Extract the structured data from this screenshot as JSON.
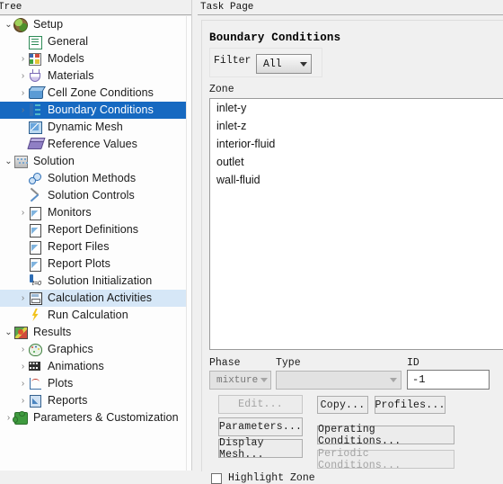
{
  "tree_panel": {
    "header": "Tree",
    "items": [
      {
        "label": "Setup",
        "icon": "setup-globe-icon",
        "level": 0,
        "arrow": "expanded",
        "state": "normal"
      },
      {
        "label": "General",
        "icon": "general-document-icon",
        "level": 1,
        "arrow": "none",
        "state": "normal"
      },
      {
        "label": "Models",
        "icon": "models-squares-icon",
        "level": 1,
        "arrow": "collapsed",
        "state": "normal"
      },
      {
        "label": "Materials",
        "icon": "materials-flask-icon",
        "level": 1,
        "arrow": "collapsed",
        "state": "normal"
      },
      {
        "label": "Cell Zone Conditions",
        "icon": "cell-zone-box-icon",
        "level": 1,
        "arrow": "collapsed",
        "state": "normal"
      },
      {
        "label": "Boundary Conditions",
        "icon": "boundary-conditions-icon",
        "level": 1,
        "arrow": "collapsed",
        "state": "selected"
      },
      {
        "label": "Dynamic Mesh",
        "icon": "dynamic-mesh-icon",
        "level": 1,
        "arrow": "none",
        "state": "normal"
      },
      {
        "label": "Reference Values",
        "icon": "reference-values-book-icon",
        "level": 1,
        "arrow": "none",
        "state": "normal"
      },
      {
        "label": "Solution",
        "icon": "solution-building-icon",
        "level": 0,
        "arrow": "expanded",
        "state": "normal"
      },
      {
        "label": "Solution Methods",
        "icon": "solution-methods-icon",
        "level": 1,
        "arrow": "none",
        "state": "normal"
      },
      {
        "label": "Solution Controls",
        "icon": "solution-controls-icon",
        "level": 1,
        "arrow": "none",
        "state": "normal"
      },
      {
        "label": "Monitors",
        "icon": "monitors-document-icon",
        "level": 1,
        "arrow": "collapsed",
        "state": "normal"
      },
      {
        "label": "Report Definitions",
        "icon": "report-definitions-icon",
        "level": 1,
        "arrow": "none",
        "state": "normal"
      },
      {
        "label": "Report Files",
        "icon": "report-files-icon",
        "level": 1,
        "arrow": "none",
        "state": "normal"
      },
      {
        "label": "Report Plots",
        "icon": "report-plots-icon",
        "level": 1,
        "arrow": "none",
        "state": "normal"
      },
      {
        "label": "Solution Initialization",
        "icon": "solution-initialization-icon",
        "level": 1,
        "arrow": "none",
        "state": "normal"
      },
      {
        "label": "Calculation Activities",
        "icon": "calculation-activities-icon",
        "level": 1,
        "arrow": "collapsed",
        "state": "hover"
      },
      {
        "label": "Run Calculation",
        "icon": "run-calculation-lightning-icon",
        "level": 1,
        "arrow": "none",
        "state": "normal"
      },
      {
        "label": "Results",
        "icon": "results-cube-icon",
        "level": 0,
        "arrow": "expanded",
        "state": "normal"
      },
      {
        "label": "Graphics",
        "icon": "graphics-palette-icon",
        "level": 1,
        "arrow": "collapsed",
        "state": "normal"
      },
      {
        "label": "Animations",
        "icon": "animations-filmstrip-icon",
        "level": 1,
        "arrow": "collapsed",
        "state": "normal"
      },
      {
        "label": "Plots",
        "icon": "plots-curve-icon",
        "level": 1,
        "arrow": "collapsed",
        "state": "normal"
      },
      {
        "label": "Reports",
        "icon": "reports-icon",
        "level": 1,
        "arrow": "collapsed",
        "state": "normal"
      },
      {
        "label": "Parameters & Customization",
        "icon": "parameters-puzzle-icon",
        "level": 0,
        "arrow": "collapsed",
        "state": "normal"
      }
    ]
  },
  "task_page": {
    "header": "Task Page",
    "title": "Boundary Conditions",
    "filter": {
      "label": "Filter",
      "value": "All",
      "options": [
        "All"
      ]
    },
    "zone": {
      "label": "Zone",
      "items": [
        "inlet-y",
        "inlet-z",
        "interior-fluid",
        "outlet",
        "wall-fluid"
      ]
    },
    "phase": {
      "label": "Phase",
      "value": "mixture",
      "disabled": true
    },
    "type": {
      "label": "Type",
      "value": "",
      "disabled": true
    },
    "id": {
      "label": "ID",
      "value": "-1"
    },
    "buttons": {
      "edit": "Edit...",
      "parameters": "Parameters...",
      "display_mesh": "Display Mesh...",
      "copy": "Copy...",
      "profiles": "Profiles...",
      "operating_conditions": "Operating Conditions...",
      "periodic_conditions": "Periodic Conditions..."
    },
    "highlight_zone": {
      "label": "Highlight Zone",
      "checked": false
    }
  },
  "colors": {
    "selection_blue": "#1669c1",
    "hover_blue": "#d6e7f7",
    "panel_bg": "#f0f0f0",
    "list_bg": "#ffffff"
  }
}
